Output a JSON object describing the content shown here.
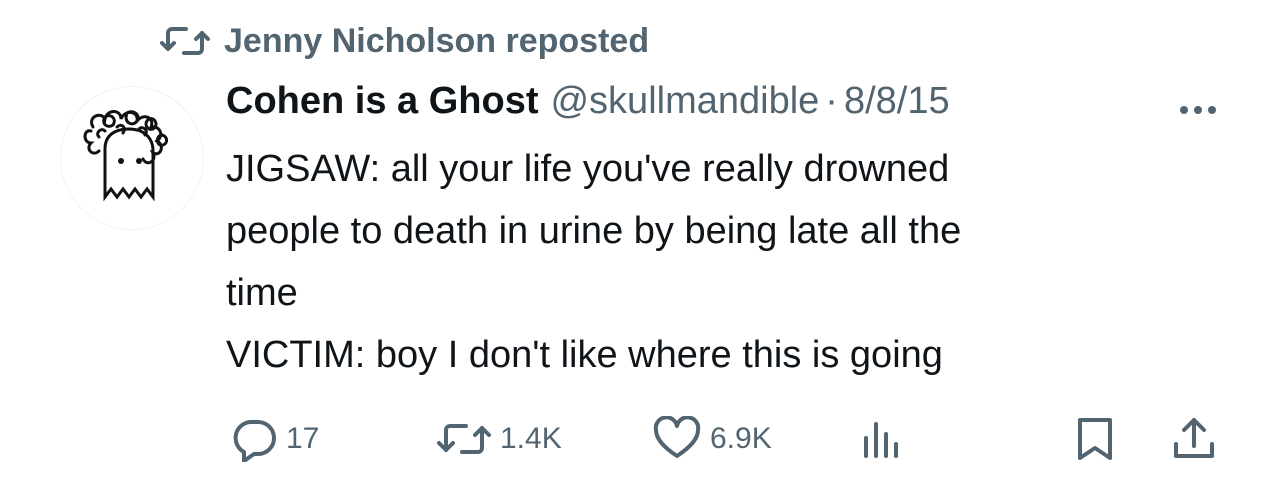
{
  "repost_banner": {
    "icon": "repost-icon",
    "text": "Jenny Nicholson reposted"
  },
  "tweet": {
    "avatar_icon": "ghost-avatar-icon",
    "display_name": "Cohen is a Ghost",
    "handle": "@skullmandible",
    "separator": "·",
    "date": "8/8/15",
    "more_icon": "more-icon",
    "text_lines": [
      "JIGSAW: all your life you've really drowned",
      "people to death in urine by being late all the",
      "time",
      "VICTIM: boy I don't like where this is going"
    ]
  },
  "actions": {
    "reply": {
      "icon": "reply-icon",
      "count": "17"
    },
    "repost": {
      "icon": "repost-icon",
      "count": "1.4K"
    },
    "like": {
      "icon": "heart-icon",
      "count": "6.9K"
    },
    "views": {
      "icon": "views-chart-icon"
    },
    "bookmark": {
      "icon": "bookmark-icon"
    },
    "share": {
      "icon": "share-icon"
    }
  },
  "colors": {
    "text_primary": "#0f1419",
    "text_secondary": "#536471",
    "background": "#ffffff"
  }
}
